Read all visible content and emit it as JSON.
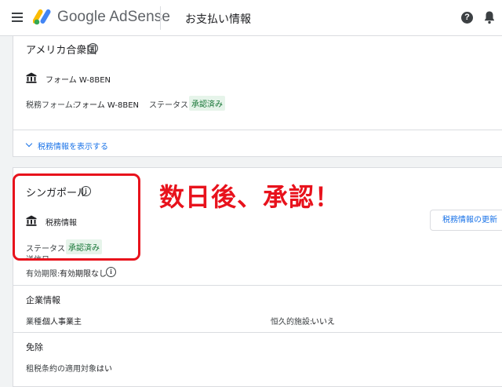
{
  "header": {
    "brand": "Google AdSense",
    "page_title": "お支払い情報",
    "help_glyph": "?"
  },
  "usa_section": {
    "country": "アメリカ合衆国",
    "form_name": "フォーム W-8BEN",
    "tax_form_label": "税務フォーム:",
    "tax_form_value": "フォーム W-8BEN",
    "status_label": "ステータス:",
    "status_value": "承認済み",
    "show_tax_info_link": "税務情報を表示する"
  },
  "singapore_section": {
    "country": "シンガポール",
    "item_name": "税務情報",
    "status_label": "ステータス:",
    "status_value": "承認済み",
    "sent_date_label": "送信日:",
    "expiry_label": "有効期限:",
    "expiry_value": "有効期限なし",
    "update_button": "税務情報の更新"
  },
  "business_info": {
    "heading": "企業情報",
    "industry_label": "業種:",
    "industry_value": "個人事業主",
    "pe_label": "恒久的施設:",
    "pe_value": "いいえ"
  },
  "exemption": {
    "heading": "免除",
    "treaty_label": "租税条約の適用対象:",
    "treaty_value": "はい"
  },
  "annotation": {
    "text": "数日後、承認！"
  },
  "icons": [
    "menu-icon",
    "adsense-logo-icon",
    "help-icon",
    "bell-icon",
    "info-icon",
    "bank-icon",
    "chevron-down-icon"
  ],
  "colors": {
    "accent": "#1a73e8",
    "approved_bg": "#e6f4ea",
    "approved_text": "#137333",
    "annotation_red": "#e8121c"
  }
}
